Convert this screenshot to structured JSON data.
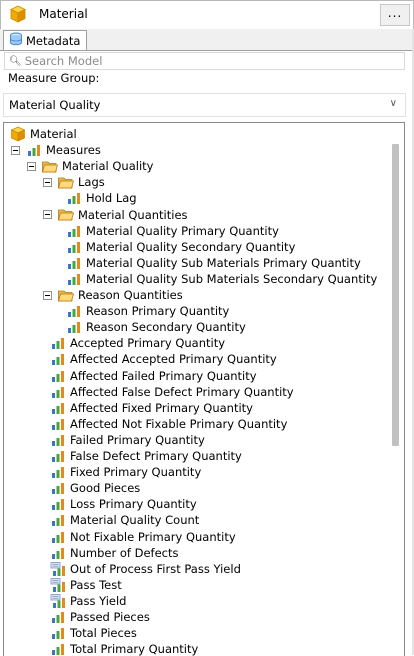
{
  "cube": {
    "title": "Material",
    "more_label": "..."
  },
  "tab": {
    "label": "Metadata"
  },
  "search": {
    "placeholder": "Search Model"
  },
  "measure_group": {
    "label": "Measure Group:",
    "value": "Material Quality"
  },
  "tree": [
    {
      "depth": 0,
      "expander": false,
      "icon": "cube-icon",
      "label": "Material"
    },
    {
      "depth": 1,
      "expander": true,
      "icon": "measures-icon",
      "label": "Measures"
    },
    {
      "depth": 2,
      "expander": true,
      "icon": "folder-icon",
      "label": "Material Quality"
    },
    {
      "depth": 3,
      "expander": true,
      "icon": "folder-icon",
      "label": "Lags"
    },
    {
      "depth": 5,
      "expander": false,
      "icon": "measure-icon",
      "label": "Hold Lag"
    },
    {
      "depth": 3,
      "expander": true,
      "icon": "folder-icon",
      "label": "Material Quantities"
    },
    {
      "depth": 5,
      "expander": false,
      "icon": "measure-icon",
      "label": "Material Quality Primary Quantity"
    },
    {
      "depth": 5,
      "expander": false,
      "icon": "measure-icon",
      "label": "Material Quality Secondary Quantity"
    },
    {
      "depth": 5,
      "expander": false,
      "icon": "measure-icon",
      "label": "Material Quality Sub Materials Primary Quantity"
    },
    {
      "depth": 5,
      "expander": false,
      "icon": "measure-icon",
      "label": "Material Quality Sub Materials Secondary Quantity"
    },
    {
      "depth": 3,
      "expander": true,
      "icon": "folder-icon",
      "label": "Reason Quantities"
    },
    {
      "depth": 5,
      "expander": false,
      "icon": "measure-icon",
      "label": "Reason Primary Quantity"
    },
    {
      "depth": 5,
      "expander": false,
      "icon": "measure-icon",
      "label": "Reason Secondary Quantity"
    },
    {
      "depth": 4,
      "expander": false,
      "icon": "measure-icon",
      "label": "Accepted Primary Quantity"
    },
    {
      "depth": 4,
      "expander": false,
      "icon": "measure-icon",
      "label": "Affected Accepted Primary Quantity"
    },
    {
      "depth": 4,
      "expander": false,
      "icon": "measure-icon",
      "label": "Affected Failed Primary Quantity"
    },
    {
      "depth": 4,
      "expander": false,
      "icon": "measure-icon",
      "label": "Affected False Defect Primary Quantity"
    },
    {
      "depth": 4,
      "expander": false,
      "icon": "measure-icon",
      "label": "Affected Fixed Primary Quantity"
    },
    {
      "depth": 4,
      "expander": false,
      "icon": "measure-icon",
      "label": "Affected Not Fixable Primary Quantity"
    },
    {
      "depth": 4,
      "expander": false,
      "icon": "measure-icon",
      "label": "Failed Primary Quantity"
    },
    {
      "depth": 4,
      "expander": false,
      "icon": "measure-icon",
      "label": "False Defect Primary Quantity"
    },
    {
      "depth": 4,
      "expander": false,
      "icon": "measure-icon",
      "label": "Fixed Primary Quantity"
    },
    {
      "depth": 4,
      "expander": false,
      "icon": "measure-icon",
      "label": "Good Pieces"
    },
    {
      "depth": 4,
      "expander": false,
      "icon": "measure-icon",
      "label": "Loss Primary Quantity"
    },
    {
      "depth": 4,
      "expander": false,
      "icon": "measure-icon",
      "label": "Material Quality Count"
    },
    {
      "depth": 4,
      "expander": false,
      "icon": "measure-icon",
      "label": "Not Fixable Primary Quantity"
    },
    {
      "depth": 4,
      "expander": false,
      "icon": "measure-icon",
      "label": "Number of Defects"
    },
    {
      "depth": 4,
      "expander": false,
      "icon": "kpi-icon",
      "label": "Out of Process First Pass Yield"
    },
    {
      "depth": 4,
      "expander": false,
      "icon": "kpi-icon",
      "label": "Pass Test"
    },
    {
      "depth": 4,
      "expander": false,
      "icon": "kpi-icon",
      "label": "Pass Yield"
    },
    {
      "depth": 4,
      "expander": false,
      "icon": "measure-icon",
      "label": "Passed Pieces"
    },
    {
      "depth": 4,
      "expander": false,
      "icon": "measure-icon",
      "label": "Total Pieces"
    },
    {
      "depth": 4,
      "expander": false,
      "icon": "measure-icon",
      "label": "Total Primary Quantity"
    }
  ]
}
